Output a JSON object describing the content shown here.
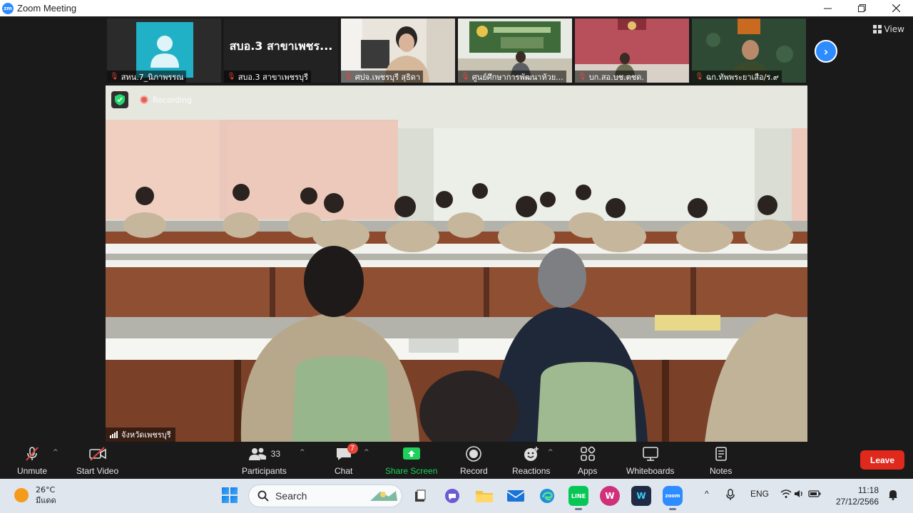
{
  "window": {
    "title": "Zoom Meeting",
    "app_logo": "zm"
  },
  "gallery": {
    "thumbnails": [
      {
        "name": "สหน.7_นิภาพรรณ",
        "muted": true
      },
      {
        "name": "สบอ.3 สาขาเพชรบุรี",
        "muted": true,
        "card_text": "สบอ.3 สาขาเพชร..."
      },
      {
        "name": "ศปจ.เพชรบุรี สุธิดา",
        "muted": true
      },
      {
        "name": "ศูนย์ศึกษาการพัฒนาห้วย...",
        "muted": true
      },
      {
        "name": "บก.สอ.บช.ตชด.",
        "muted": true
      },
      {
        "name": "ฉก.ทัพพระยาเสือ/ร.๙",
        "muted": true
      }
    ],
    "view_label": "View"
  },
  "main_video": {
    "recording_label": "Recording",
    "speaker_name": "จังหวัดเพชรบุรี"
  },
  "toolbar": {
    "unmute": "Unmute",
    "start_video": "Start Video",
    "participants": "Participants",
    "participants_count": "33",
    "chat": "Chat",
    "chat_badge": "7",
    "share_screen": "Share Screen",
    "record": "Record",
    "reactions": "Reactions",
    "apps": "Apps",
    "whiteboards": "Whiteboards",
    "notes": "Notes",
    "leave": "Leave"
  },
  "taskbar": {
    "weather_temp": "26°C",
    "weather_desc": "มีแดด",
    "search_placeholder": "Search",
    "language": "ENG",
    "time": "11:18",
    "date": "27/12/2566"
  },
  "colors": {
    "zoom_blue": "#2d8cff",
    "leave_red": "#e0291d",
    "share_green": "#1fd05a",
    "avatar_teal": "#21b1c7"
  }
}
